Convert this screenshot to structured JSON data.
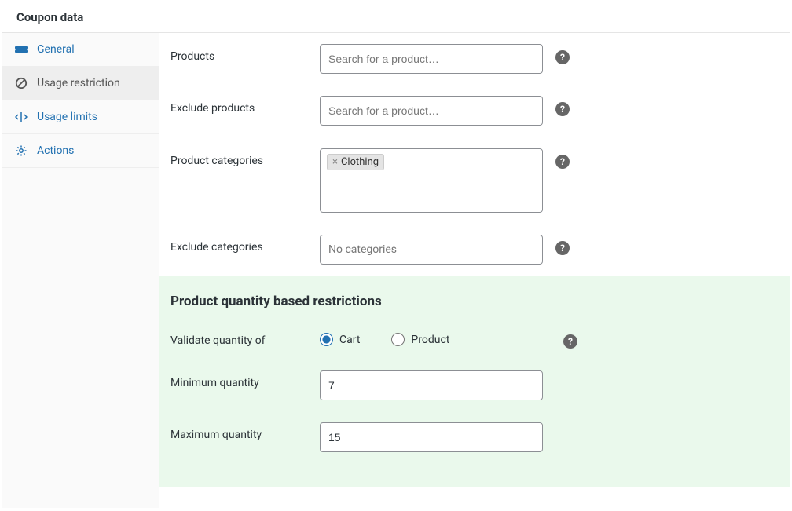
{
  "header": {
    "title": "Coupon data"
  },
  "tabs": {
    "general": "General",
    "usage_restriction": "Usage restriction",
    "usage_limits": "Usage limits",
    "actions": "Actions"
  },
  "fields": {
    "products": {
      "label": "Products",
      "placeholder": "Search for a product…"
    },
    "exclude_products": {
      "label": "Exclude products",
      "placeholder": "Search for a product…"
    },
    "product_categories": {
      "label": "Product categories",
      "chips": [
        "Clothing"
      ]
    },
    "exclude_categories": {
      "label": "Exclude categories",
      "placeholder": "No categories"
    }
  },
  "qty_section": {
    "title": "Product quantity based restrictions",
    "validate_label": "Validate quantity of",
    "opt_cart": "Cart",
    "opt_product": "Product",
    "selected": "cart",
    "min_label": "Minimum quantity",
    "min_value": "7",
    "max_label": "Maximum quantity",
    "max_value": "15"
  },
  "help_glyph": "?",
  "remove_glyph": "×"
}
